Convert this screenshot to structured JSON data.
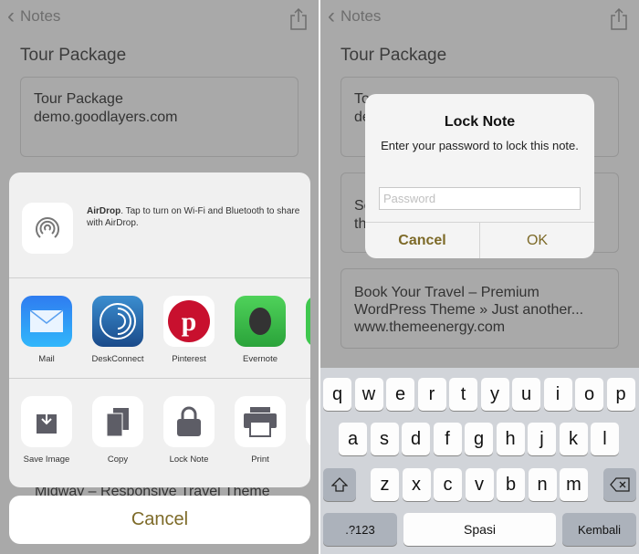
{
  "left": {
    "nav_back": "Notes",
    "note_title": "Tour Package",
    "card1": {
      "title": "Tour Package",
      "url": "demo.goodlayers.com"
    },
    "behind_text": "Midway – Responsive Travel Theme",
    "airdrop": {
      "bold": "AirDrop",
      "text": ". Tap to turn on Wi-Fi and Bluetooth to share with AirDrop."
    },
    "apps": [
      {
        "label": "Mail"
      },
      {
        "label": "DeskConnect"
      },
      {
        "label": "Pinterest"
      },
      {
        "label": "Evernote"
      }
    ],
    "actions": [
      {
        "label": "Save Image"
      },
      {
        "label": "Copy"
      },
      {
        "label": "Lock Note"
      },
      {
        "label": "Print"
      }
    ],
    "cancel": "Cancel"
  },
  "right": {
    "nav_back": "Notes",
    "note_title": "Tour Package",
    "card1_partial": "To\nde",
    "card2_partial": "Se\nth",
    "card3": {
      "title": "Book Your Travel – Premium WordPress Theme » Just another...",
      "url": "www.themeenergy.com"
    },
    "alert": {
      "title": "Lock Note",
      "message": "Enter your password to lock this note.",
      "placeholder": "Password",
      "value": "",
      "cancel": "Cancel",
      "ok": "OK"
    },
    "keyboard": {
      "row1": [
        "q",
        "w",
        "e",
        "r",
        "t",
        "y",
        "u",
        "i",
        "o",
        "p"
      ],
      "row2": [
        "a",
        "s",
        "d",
        "f",
        "g",
        "h",
        "j",
        "k",
        "l"
      ],
      "row3": [
        "z",
        "x",
        "c",
        "v",
        "b",
        "n",
        "m"
      ],
      "numbers": ".?123",
      "space": "Spasi",
      "return": "Kembali"
    }
  },
  "colors": {
    "accent": "#7d6a28"
  }
}
